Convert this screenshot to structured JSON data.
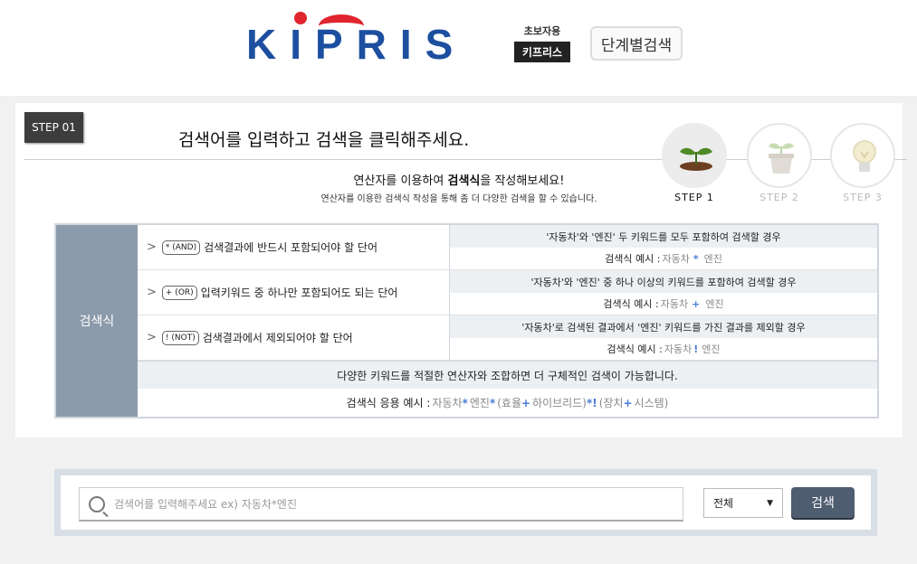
{
  "header": {
    "logo_text": "KIPRIS",
    "beginner_sub": "초보자용",
    "beginner_main": "키프리스",
    "step_search_label": "단계별검색"
  },
  "main": {
    "step_badge": "STEP 01",
    "title": "검색어를 입력하고 검색을 클릭해주세요.",
    "subtitle_prefix": "연산자를 이용하여 ",
    "subtitle_bold": "검색식",
    "subtitle_suffix": "을 작성해보세요!",
    "description": "연산자를 이용한 검색식 작성을 통해 좀 더 다양한 검색을 할 수 있습니다.",
    "steps": [
      {
        "label": "STEP 1",
        "icon": "sprout-icon",
        "active": true
      },
      {
        "label": "STEP 2",
        "icon": "flowerpot-icon",
        "active": false
      },
      {
        "label": "STEP 3",
        "icon": "lightbulb-icon",
        "active": false
      }
    ]
  },
  "operator_table": {
    "side_label": "검색식",
    "rows": [
      {
        "badge": "* (AND)",
        "desc": "검색결과에 반드시 포함되어야 할 단어",
        "example_head": "'자동차'와 '엔진' 두 키워드를 모두 포함하여 검색할 경우",
        "example_label": "검색식 예시 : ",
        "example_a": "자동차",
        "example_op": "*",
        "example_b": "엔진"
      },
      {
        "badge": "+ (OR)",
        "desc": "입력키워드 중 하나만 포함되어도 되는 단어",
        "example_head": "'자동차'와 '엔진' 중 하나 이상의 키워드를 포함하여 검색할 경우",
        "example_label": "검색식 예시 : ",
        "example_a": "자동차",
        "example_op": "+",
        "example_b": "엔진"
      },
      {
        "badge": "! (NOT)",
        "desc": "검색결과에서 제외되어야 할 단어",
        "example_head": "'자동차'로 검색된 결과에서 '엔진' 키워드를 가진 결과를 제외할 경우",
        "example_label": "검색식 예시 : ",
        "example_a": "자동차",
        "example_op": "!",
        "example_b": "엔진"
      }
    ],
    "bottom_head": "다양한 키워드를 적절한 연산자와 조합하면 더 구체적인 검색이 가능합니다.",
    "bottom_label": "검색식 응용 예시 : ",
    "bottom_parts": [
      "자동차",
      "*",
      "엔진",
      "*",
      "(효율",
      "+",
      "하이브리드)",
      "*",
      "!",
      "(장치",
      "+",
      "시스템)"
    ]
  },
  "search": {
    "placeholder": "검색어를 입력해주세요 ex) 자동차*엔진",
    "select_value": "전체",
    "button_label": "검색"
  }
}
